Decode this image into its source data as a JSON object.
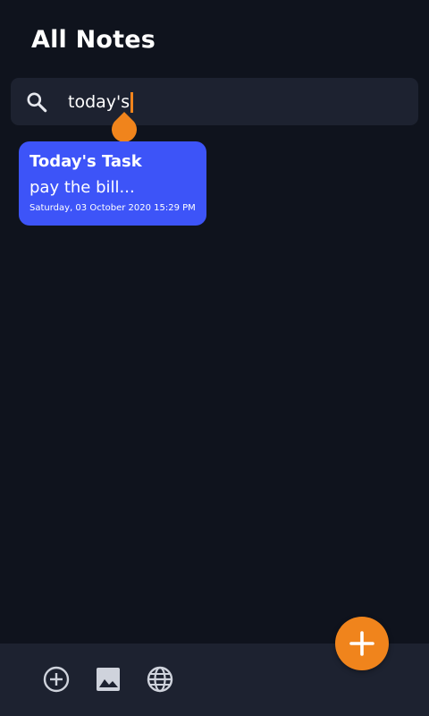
{
  "header": {
    "title": "All Notes"
  },
  "search": {
    "value": "today's",
    "icon": "search-icon"
  },
  "notes": [
    {
      "title": "Today's Task",
      "body": "pay the bill...",
      "date": "Saturday, 03 October 2020 15:29 PM",
      "color": "#3d54f8"
    }
  ],
  "bottom_bar": {
    "icons": [
      "add-circle-icon",
      "image-icon",
      "globe-icon"
    ]
  },
  "fab": {
    "icon": "plus-icon"
  },
  "colors": {
    "background": "#0f131d",
    "surface": "#1d2230",
    "accent": "#f0841c",
    "note_blue": "#3d54f8"
  }
}
